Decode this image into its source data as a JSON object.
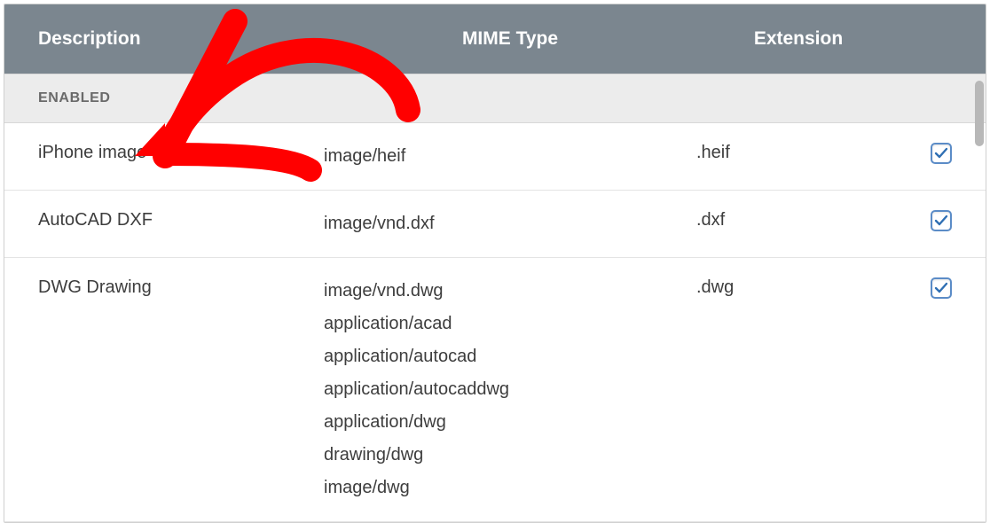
{
  "header": {
    "description": "Description",
    "mime": "MIME Type",
    "extension": "Extension"
  },
  "section_label": "ENABLED",
  "rows": [
    {
      "description": "iPhone image",
      "mimes": [
        "image/heif"
      ],
      "extension": ".heif",
      "checked": true
    },
    {
      "description": "AutoCAD DXF",
      "mimes": [
        "image/vnd.dxf"
      ],
      "extension": ".dxf",
      "checked": true
    },
    {
      "description": "DWG Drawing",
      "mimes": [
        "image/vnd.dwg",
        "application/acad",
        "application/autocad",
        "application/autocaddwg",
        "application/dwg",
        "drawing/dwg",
        "image/dwg"
      ],
      "extension": ".dwg",
      "checked": true
    }
  ],
  "colors": {
    "header_bg": "#7b868f",
    "section_bg": "#ececec",
    "check_border": "#5b8cc7",
    "check_mark": "#2f6fb3",
    "annotation": "#ff0000"
  }
}
